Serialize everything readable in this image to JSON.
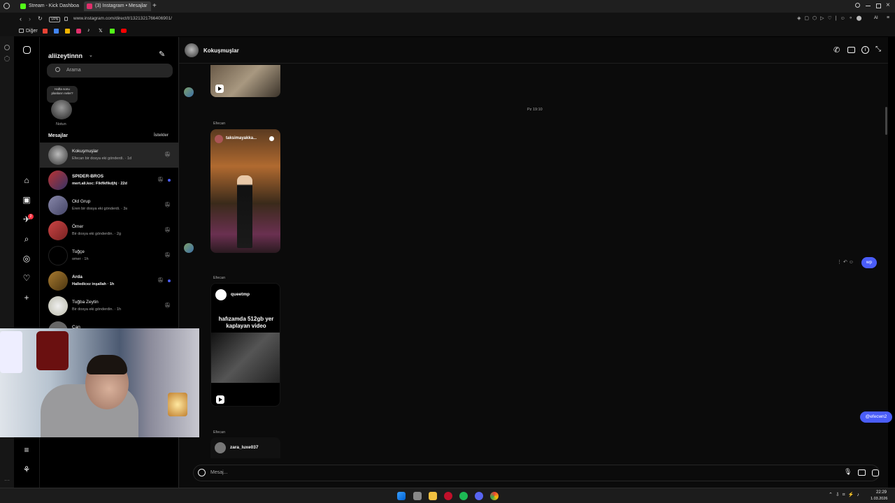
{
  "browser": {
    "tabs": [
      {
        "label": "Stream - Kick Dashboa",
        "color": "#53fc18"
      },
      {
        "label": "(3) Instagram • Mesajlar",
        "color": "#e1306c"
      }
    ],
    "url": "www.instagram.com/direct/t/1321321766406901/",
    "vpn_label": "VPN",
    "bookmark_folder": "Diğer",
    "ai_label": "AI"
  },
  "instagram": {
    "username": "aliizeytinnn",
    "search_placeholder": "Arama",
    "note_bubble": "Hafta sonu planların neler?",
    "note_label": "Notun",
    "messages_heading": "Mesajlar",
    "requests_link": "İstekler",
    "nav_badge": "2",
    "conversations": [
      {
        "name": "Kokuşmuşlar",
        "preview": "Efecan bir dosya eki gönderdi. · 1d",
        "unread": false,
        "dot": false,
        "active": true
      },
      {
        "name": "SPIDER-BROS",
        "preview": "mert.ali.koc: Flkflkflkdjhj · 22d",
        "unread": true,
        "dot": true,
        "active": false
      },
      {
        "name": "Old Grup",
        "preview": "Eren bir dosya eki gönderdi. · 3s",
        "unread": false,
        "dot": false,
        "active": false
      },
      {
        "name": "Ömer",
        "preview": "Bir dosya eki gönderdin. · 2g",
        "unread": false,
        "dot": false,
        "active": false
      },
      {
        "name": "Tuğçe",
        "preview": "omer · 1h",
        "unread": false,
        "dot": false,
        "active": false
      },
      {
        "name": "Arda",
        "preview": "Halledicez inşallah · 1h",
        "unread": true,
        "dot": true,
        "active": false
      },
      {
        "name": "Tuğba Zeytin",
        "preview": "Bir dosya eki gönderdin. · 1h",
        "unread": false,
        "dot": false,
        "active": false
      },
      {
        "name": "Can",
        "preview": "",
        "unread": false,
        "dot": false,
        "active": false
      }
    ],
    "chat": {
      "title": "Kokuşmuşlar",
      "timestamp": "Pz 19:10",
      "sender1": "Efecan",
      "post1_user": "taksimayakka...",
      "sender2": "Efecan",
      "post2_user": "queetmp",
      "post2_caption": "hafızamda 512gb yer kaplayan video",
      "sender3": "Efecan",
      "post3_user": "zara_luxe037",
      "my_msg1": "wp",
      "my_msg2": "@efecwn2",
      "composer_placeholder": "Mesaj..."
    }
  },
  "taskbar": {
    "time": "22:29",
    "date": "1.03.2026"
  }
}
